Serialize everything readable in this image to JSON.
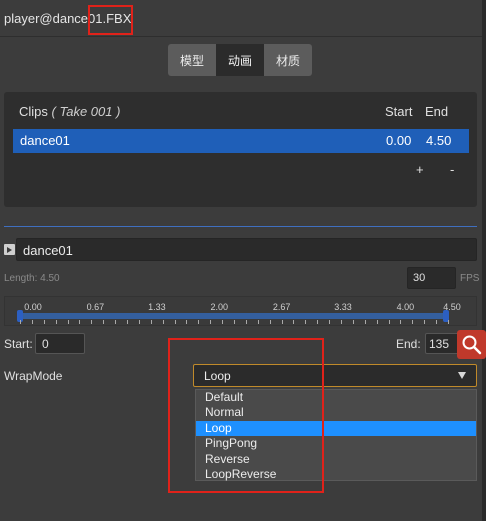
{
  "header": {
    "title": "player@dance01.FBX"
  },
  "tabs": [
    {
      "label": "模型",
      "active": false
    },
    {
      "label": "动画",
      "active": true
    },
    {
      "label": "材质",
      "active": false
    }
  ],
  "clips": {
    "header_label": "Clips",
    "header_sub": "( Take 001 )",
    "col_start": "Start",
    "col_end": "End",
    "rows": [
      {
        "name": "dance01",
        "start": "0.00",
        "end": "4.50"
      }
    ],
    "add_label": "+",
    "remove_label": "-"
  },
  "clip_editor": {
    "name": "dance01",
    "length_label": "Length: 4.50",
    "fps_value": "30",
    "fps_label": "FPS",
    "ticks": [
      "0.00",
      "0.67",
      "1.33",
      "2.00",
      "2.67",
      "3.33",
      "4.00",
      "4.50"
    ],
    "start_label": "Start:",
    "start_value": "0",
    "end_label": "End:",
    "end_value": "135"
  },
  "wrap_mode": {
    "label": "WrapMode",
    "selected": "Loop",
    "options": [
      "Default",
      "Normal",
      "Loop",
      "PingPong",
      "Reverse",
      "LoopReverse"
    ],
    "highlighted_index": 2
  },
  "colors": {
    "background": "#3c3c3c",
    "selection_blue": "#1f5fb8",
    "dropdown_highlight": "#1e90ff",
    "annotation_red": "#e0221a",
    "search_button": "#c0392b"
  },
  "icons": {
    "search": "magnifier-icon",
    "collapse": "collapse-triangle-icon",
    "dropdown": "chevron-down-icon"
  }
}
